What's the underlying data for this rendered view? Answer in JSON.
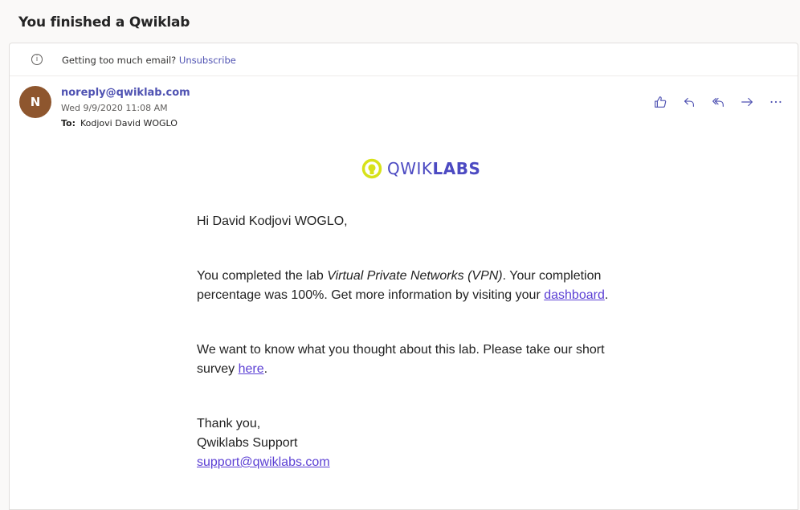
{
  "subject": "You finished a Qwiklab",
  "infobar": {
    "icon": "info-icon",
    "text": "Getting too much email?",
    "link": "Unsubscribe"
  },
  "message": {
    "avatar_initial": "N",
    "avatar_color": "#8e562e",
    "sender": "noreply@qwiklab.com",
    "date": "Wed 9/9/2020 11:08 AM",
    "to_label": "To:",
    "to_name": "Kodjovi David WOGLO"
  },
  "actions": [
    {
      "name": "like-icon"
    },
    {
      "name": "reply-icon"
    },
    {
      "name": "reply-all-icon"
    },
    {
      "name": "forward-icon"
    },
    {
      "name": "more-icon"
    }
  ],
  "logo": {
    "text_light": "QWIK",
    "text_bold": "LABS"
  },
  "body": {
    "greeting": "Hi David Kodjovi WOGLO,",
    "p1_before": "You completed the lab ",
    "p1_lab": "Virtual Private Networks (VPN)",
    "p1_after": ". Your completion percentage was 100%. Get more information by visiting your ",
    "p1_link": "dashboard",
    "p1_end": ".",
    "p2_before": "We want to know what you thought about this lab. Please take our short survey ",
    "p2_link": "here",
    "p2_end": ".",
    "thanks": "Thank you,",
    "signature": "Qwiklabs Support",
    "support_email": "support@qwiklabs.com"
  }
}
